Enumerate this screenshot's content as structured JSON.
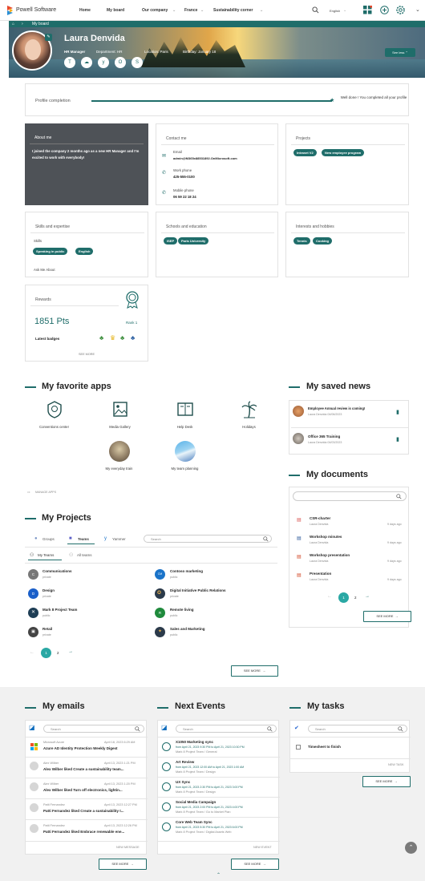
{
  "topnav": {
    "brand": "Powell Software",
    "items": [
      "Home",
      "My board",
      "Our company",
      "France",
      "Sustainability corner"
    ],
    "language": "English"
  },
  "breadcrumb": {
    "label": "My board"
  },
  "profile": {
    "name": "Laura Denvida",
    "role": "HR Manager",
    "department": "Department: HR",
    "location": "Location: Paris",
    "birthday": "Birthday: January 18",
    "see_less": "See less"
  },
  "completion": {
    "label": "Profile completion",
    "percent": 100,
    "message": "Well done ! You completed all your profile"
  },
  "about": {
    "title": "About me",
    "text": "I joined the company 2 months ago as a new HR Manager and I'm excited to work with everybody!"
  },
  "contact": {
    "title": "Contact me",
    "email_label": "Email",
    "email": "admin@M365x88531892.OnMicrosoft.com",
    "work_label": "Work phone",
    "work": "425-555-0100",
    "mobile_label": "Mobile phone",
    "mobile": "06 59 22 18 24"
  },
  "projects_card": {
    "title": "Projects",
    "tags": [
      "Intranet V2",
      "New employee program"
    ]
  },
  "skills": {
    "title": "Skills and expertise",
    "label": "Skills",
    "tags": [
      "Speaking in public",
      "English"
    ],
    "ask": "Ask Me About"
  },
  "schools": {
    "title": "Schools and education",
    "tags": [
      "ISEP",
      "Paris University"
    ]
  },
  "interests": {
    "title": "Interests and hobbies",
    "tags": [
      "Tennis",
      "Cooking"
    ]
  },
  "rewards": {
    "title": "Rewards",
    "points": "1851 Pts",
    "rank": "Rank 1",
    "badges_label": "Latest badges",
    "see_more": "SEE MORE"
  },
  "fav_apps": {
    "title": "My favorite apps",
    "apps": [
      "Conventions center",
      "Media Gallery",
      "Help Desk",
      "Holidays",
      "My everyday train",
      "My team planning"
    ],
    "manage": "MANAGE APPS"
  },
  "saved_news": {
    "title": "My saved news",
    "items": [
      {
        "title": "Employee Annual review is coming!",
        "meta": "Laura Denvida 04/06/2023"
      },
      {
        "title": "Office 365 Training",
        "meta": "Laura Denvida 04/03/2023"
      }
    ]
  },
  "documents": {
    "title": "My documents",
    "items": [
      {
        "title": "CSR-charter",
        "author": "Laura Denvida",
        "age": "9 days ago"
      },
      {
        "title": "Workshop minutes",
        "author": "Laura Denvida",
        "age": "9 days ago"
      },
      {
        "title": "Workshop presentation",
        "author": "Laura Denvida",
        "age": "9 days ago"
      },
      {
        "title": "Presentation",
        "author": "Laura Denvida",
        "age": "9 days ago"
      }
    ],
    "pages": [
      "1",
      "2"
    ],
    "see_more": "SEE MORE"
  },
  "my_projects": {
    "title": "My Projects",
    "tabs": [
      "Groups",
      "Teams",
      "Yammer"
    ],
    "search": "Search",
    "filters": [
      "My Teams",
      "All teams"
    ],
    "items": [
      {
        "name": "Communications",
        "vis": "private",
        "color": "#777777",
        "letter": "C"
      },
      {
        "name": "Contoso marketing",
        "vis": "public",
        "color": "#1a73c9",
        "letter": "CM"
      },
      {
        "name": "Design",
        "vis": "private",
        "color": "#1a5fc9",
        "letter": "D"
      },
      {
        "name": "Digital Initiative Public Relations",
        "vis": "private",
        "color": "#2b3a4a",
        "letter": ""
      },
      {
        "name": "Mark 8 Project Team",
        "vis": "public",
        "color": "#1e3e55",
        "letter": ""
      },
      {
        "name": "Remote living",
        "vis": "public",
        "color": "#1f8a3c",
        "letter": "R"
      },
      {
        "name": "Retail",
        "vis": "private",
        "color": "#444444",
        "letter": ""
      },
      {
        "name": "Sales and Marketing",
        "vis": "public",
        "color": "#2b3a4a",
        "letter": ""
      }
    ],
    "pages": [
      "1",
      "2"
    ],
    "see_more": "SEE MORE"
  },
  "emails": {
    "title": "My emails",
    "search": "Search",
    "items": [
      {
        "from": "Microsoft Azure",
        "date": "April 18, 2023 6:29 AM",
        "subject": "Azure AD Identity Protection Weekly Digest"
      },
      {
        "from": "Alex Wilber",
        "date": "April 13, 2023 1:21 PM",
        "subject": "Alex Wilber liked Create a sustainability team..."
      },
      {
        "from": "Alex Wilber",
        "date": "April 13, 2023 1:20 PM",
        "subject": "Alex Wilber liked Turn off electronics, lightin..."
      },
      {
        "from": "Patti Fernandez",
        "date": "April 13, 2023 12:27 PM",
        "subject": "Patti Fernandez liked Create a sustainability t..."
      },
      {
        "from": "Patti Fernandez",
        "date": "April 13, 2023 12:26 PM",
        "subject": "Patti Fernandez liked Embrace renewable ene..."
      }
    ],
    "new_label": "NEW MESSAGE",
    "see_more": "SEE MORE"
  },
  "events": {
    "title": "Next Events",
    "search": "Search",
    "items": [
      {
        "title": "X1050 Marketing sync",
        "when": "from April 21, 2023 9:30 PM to April 21, 2023 10:30 PM",
        "where": "Mark 8 Project Team / General"
      },
      {
        "title": "Art Review",
        "when": "from April 21, 2023 12:00 AM to April 21, 2023 1:00 AM",
        "where": "Mark 8 Project Team / Design"
      },
      {
        "title": "UX Sync",
        "when": "from April 21, 2023 2:30 PM to April 21, 2023 3:00 PM",
        "where": "Mark 8 Project Team / Design"
      },
      {
        "title": "Social Media Campaign",
        "when": "from April 21, 2023 2:00 PM to April 21, 2023 4:00 PM",
        "where": "Mark 8 Project Team / Go to Market Plan"
      },
      {
        "title": "Core Web Team Sync",
        "when": "from April 21, 2023 5:30 PM to April 21, 2023 6:00 PM",
        "where": "Mark 8 Project Team / Digital Assets Web"
      }
    ],
    "new_label": "NEW EVENT",
    "see_more": "SEE MORE"
  },
  "tasks": {
    "title": "My tasks",
    "search": "Search",
    "items": [
      "Timesheet to finish"
    ],
    "new_label": "NEW TASK",
    "see_more": "SEE MORE"
  }
}
